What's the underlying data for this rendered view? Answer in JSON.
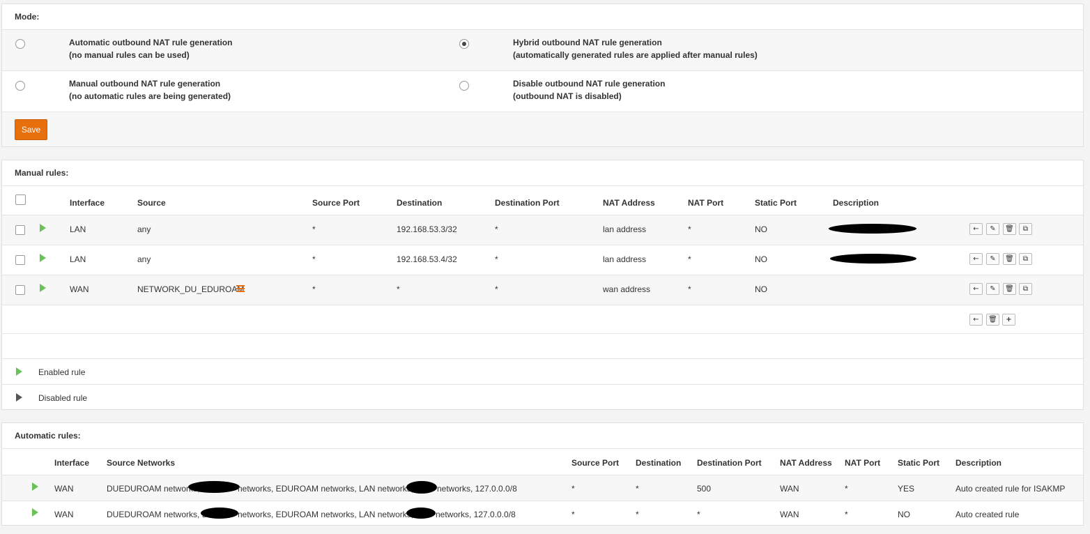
{
  "mode": {
    "header": "Mode:",
    "options": [
      {
        "title": "Automatic outbound NAT rule generation",
        "subtitle": "(no manual rules can be used)",
        "selected": false
      },
      {
        "title": "Hybrid outbound NAT rule generation",
        "subtitle": "(automatically generated rules are applied after manual rules)",
        "selected": true
      },
      {
        "title": "Manual outbound NAT rule generation",
        "subtitle": "(no automatic rules are being generated)",
        "selected": false
      },
      {
        "title": "Disable outbound NAT rule generation",
        "subtitle": "(outbound NAT is disabled)",
        "selected": false
      }
    ],
    "save_label": "Save"
  },
  "manual": {
    "header": "Manual rules:",
    "columns": [
      "Interface",
      "Source",
      "Source Port",
      "Destination",
      "Destination Port",
      "NAT Address",
      "NAT Port",
      "Static Port",
      "Description"
    ],
    "rows": [
      {
        "interface": "LAN",
        "source": "any",
        "source_port": "*",
        "destination": "192.168.53.3/32",
        "destination_port": "*",
        "nat_address": "lan address",
        "nat_port": "*",
        "static_port": "NO"
      },
      {
        "interface": "LAN",
        "source": "any",
        "source_port": "*",
        "destination": "192.168.53.4/32",
        "destination_port": "*",
        "nat_address": "lan address",
        "nat_port": "*",
        "static_port": "NO"
      },
      {
        "interface": "WAN",
        "source": "NETWORK_DU_EDUROAM",
        "source_port": "*",
        "destination": "*",
        "destination_port": "*",
        "nat_address": "wan address",
        "nat_port": "*",
        "static_port": "NO"
      }
    ],
    "legend": {
      "enabled": "Enabled rule",
      "disabled": "Disabled rule"
    }
  },
  "automatic": {
    "header": "Automatic rules:",
    "columns": [
      "Interface",
      "Source Networks",
      "Source Port",
      "Destination",
      "Destination Port",
      "NAT Address",
      "NAT Port",
      "Static Port",
      "Description"
    ],
    "rows": [
      {
        "interface": "WAN",
        "src_a": "DUEDUROAM networks,",
        "src_b": "networks, EDUROAM networks, LAN networks,",
        "src_c": "networks, 127.0.0.0/8",
        "source_port": "*",
        "destination": "*",
        "destination_port": "500",
        "nat_address": "WAN",
        "nat_port": "*",
        "static_port": "YES",
        "description": "Auto created rule for ISAKMP"
      },
      {
        "interface": "WAN",
        "src_a": "DUEDUROAM networks, D",
        "src_b": "networks, EDUROAM networks, LAN networks,",
        "src_c": "networks, 127.0.0.0/8",
        "source_port": "*",
        "destination": "*",
        "destination_port": "*",
        "nat_address": "WAN",
        "nat_port": "*",
        "static_port": "NO",
        "description": "Auto created rule"
      }
    ]
  },
  "colors": {
    "accent": "#e8700c",
    "enabled": "#6cc25a",
    "disabled": "#555555"
  },
  "icons": {
    "row_actions": [
      "arrow-left-icon",
      "pencil-icon",
      "trash-icon",
      "copy-icon"
    ],
    "footer_actions": [
      "arrow-left-icon",
      "trash-icon",
      "plus-icon"
    ]
  }
}
